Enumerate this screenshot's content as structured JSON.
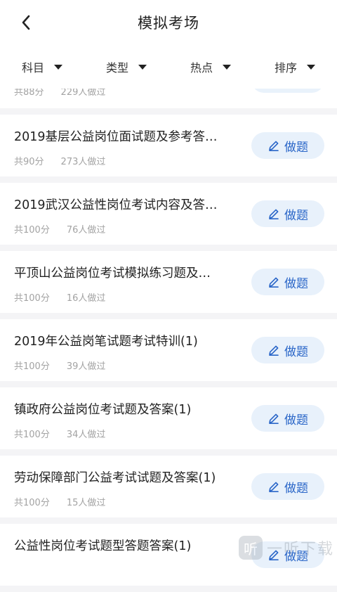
{
  "header": {
    "title": "模拟考场"
  },
  "filters": [
    {
      "label": "科目"
    },
    {
      "label": "类型"
    },
    {
      "label": "热点"
    },
    {
      "label": "排序"
    }
  ],
  "partial_item": {
    "score": "共88分",
    "count": "229人做过"
  },
  "action_label": "做题",
  "items": [
    {
      "title": "2019基层公益岗位面试题及参考答…",
      "score": "共90分",
      "count": "273人做过"
    },
    {
      "title": "2019武汉公益性岗位考试内容及答…",
      "score": "共100分",
      "count": "76人做过"
    },
    {
      "title": "平顶山公益岗位考试模拟练习题及…",
      "score": "共100分",
      "count": "16人做过"
    },
    {
      "title": "2019年公益岗笔试题考试特训(1)",
      "score": "共100分",
      "count": "39人做过"
    },
    {
      "title": "镇政府公益岗位考试题及答案(1)",
      "score": "共100分",
      "count": "34人做过"
    },
    {
      "title": "劳动保障部门公益考试试题及答案(1)",
      "score": "共100分",
      "count": "15人做过"
    },
    {
      "title": "公益性岗位考试题型答题答案(1)",
      "score": "",
      "count": ""
    }
  ],
  "watermark": {
    "logo_char": "听",
    "text": "一听下载"
  }
}
